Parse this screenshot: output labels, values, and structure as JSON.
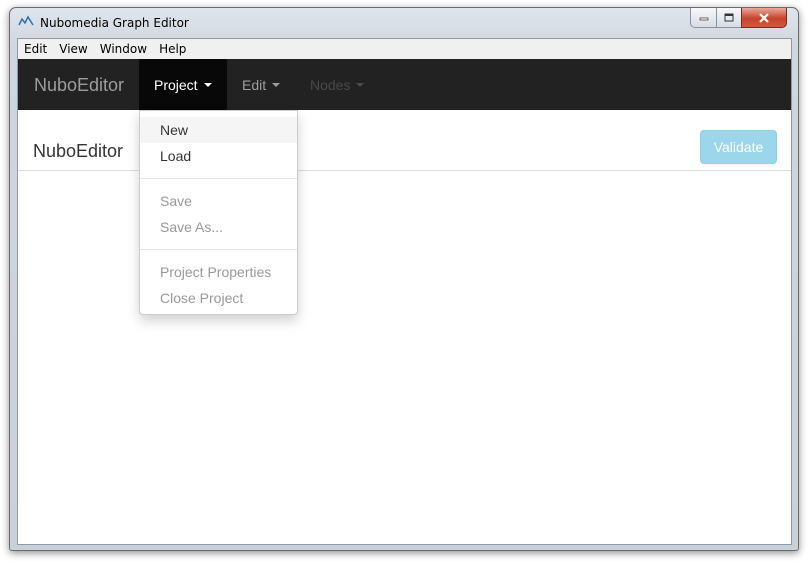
{
  "window": {
    "title": "Nubomedia Graph Editor"
  },
  "menubar": {
    "items": [
      "Edit",
      "View",
      "Window",
      "Help"
    ]
  },
  "navbar": {
    "brand": "NuboEditor",
    "items": [
      {
        "label": "Project",
        "state": "open"
      },
      {
        "label": "Edit",
        "state": "normal"
      },
      {
        "label": "Nodes",
        "state": "disabled"
      }
    ]
  },
  "dropdown": {
    "items": [
      {
        "label": "New",
        "state": "hover"
      },
      {
        "label": "Load",
        "state": "normal"
      },
      {
        "label": "Save",
        "state": "disabled"
      },
      {
        "label": "Save As...",
        "state": "disabled"
      },
      {
        "label": "Project Properties",
        "state": "disabled"
      },
      {
        "label": "Close Project",
        "state": "disabled"
      }
    ]
  },
  "main": {
    "heading": "NuboEditor",
    "validate_label": "Validate"
  },
  "colors": {
    "navbar": "#222222",
    "validate": "#9bd6ea",
    "dropdown_hover": "#f5f5f5"
  }
}
